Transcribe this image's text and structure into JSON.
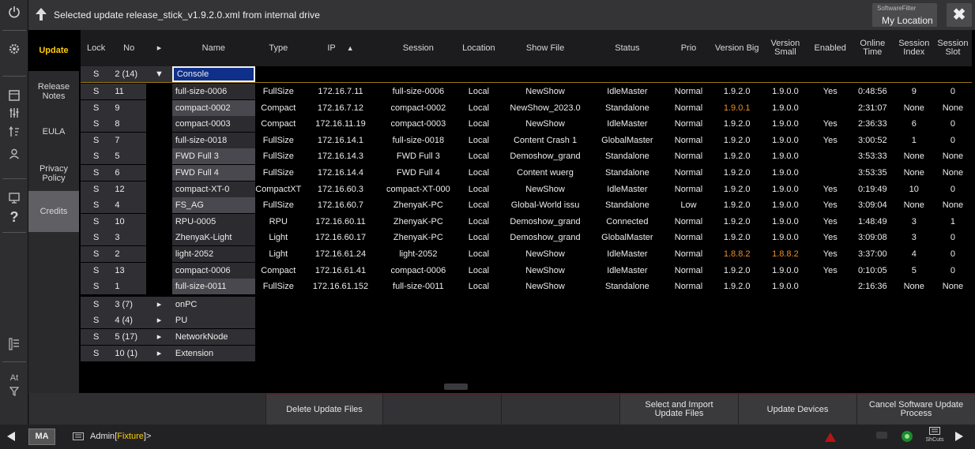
{
  "titlebar": {
    "title": "Selected update release_stick_v1.9.2.0.xml from internal drive"
  },
  "software_filter": {
    "label": "SoftwareFilter",
    "value": "My Location"
  },
  "left_icons": [
    "power-icon",
    "settings-icon",
    "view-icon",
    "filter-icon",
    "sort-icon",
    "user-icon",
    "screen-icon",
    "help-icon",
    "layers-icon",
    "at-icon",
    "funnel-icon"
  ],
  "left_labels": {
    "at": "At",
    "help": "?"
  },
  "tabs": [
    {
      "label": "Update"
    },
    {
      "label": "Release Notes"
    },
    {
      "label": "EULA"
    },
    {
      "label": "Privacy Policy"
    },
    {
      "label": "Credits"
    }
  ],
  "table": {
    "headers": {
      "lock": "Lock",
      "no": "No",
      "arrow": "▸",
      "name": "Name",
      "type": "Type",
      "ip": "IP",
      "ip_sort": "▲",
      "session": "Session",
      "location": "Location",
      "show": "Show File",
      "status": "Status",
      "prio": "Prio",
      "vbig": "Version Big",
      "vsmall": "Version Small",
      "enabled": "Enabled",
      "online": "Online Time",
      "sidx": "Session Index",
      "sslot": "Session Slot"
    },
    "group_rows": [
      {
        "lock": "S",
        "no": "2 (14)",
        "arrow": "▼",
        "name": "Console"
      },
      {
        "lock": "S",
        "no": "3 (7)",
        "arrow": "▸",
        "name": "onPC"
      },
      {
        "lock": "S",
        "no": "4 (4)",
        "arrow": "▸",
        "name": "PU"
      },
      {
        "lock": "S",
        "no": "5 (17)",
        "arrow": "▸",
        "name": "NetworkNode"
      },
      {
        "lock": "S",
        "no": "10 (1)",
        "arrow": "▸",
        "name": "Extension"
      }
    ],
    "rows": [
      {
        "lock": "S",
        "no": "11",
        "name": "full-size-0006",
        "type": "FullSize",
        "ip": "172.16.7.11",
        "session": "full-size-0006",
        "location": "Local",
        "show": "NewShow",
        "status": "IdleMaster",
        "prio": "Normal",
        "vbig": "1.9.2.0",
        "vsmall": "1.9.0.0",
        "enabled": "Yes",
        "online": "0:48:56",
        "sidx": "9",
        "sslot": "0"
      },
      {
        "lock": "S",
        "no": "9",
        "name": "compact-0002",
        "type": "Compact",
        "ip": "172.16.7.12",
        "session": "compact-0002",
        "location": "Local",
        "show": "NewShow_2023.0",
        "status": "Standalone",
        "prio": "Normal",
        "vbig": "1.9.0.1",
        "vsmall": "1.9.0.0",
        "enabled": "",
        "online": "2:31:07",
        "sidx": "None",
        "sslot": "None"
      },
      {
        "lock": "S",
        "no": "8",
        "name": "compact-0003",
        "type": "Compact",
        "ip": "172.16.11.19",
        "session": "compact-0003",
        "location": "Local",
        "show": "NewShow",
        "status": "IdleMaster",
        "prio": "Normal",
        "vbig": "1.9.2.0",
        "vsmall": "1.9.0.0",
        "enabled": "Yes",
        "online": "2:36:33",
        "sidx": "6",
        "sslot": "0"
      },
      {
        "lock": "S",
        "no": "7",
        "name": "full-size-0018",
        "type": "FullSize",
        "ip": "172.16.14.1",
        "session": "full-size-0018",
        "location": "Local",
        "show": "Content Crash 1",
        "status": "GlobalMaster",
        "prio": "Normal",
        "vbig": "1.9.2.0",
        "vsmall": "1.9.0.0",
        "enabled": "Yes",
        "online": "3:00:52",
        "sidx": "1",
        "sslot": "0"
      },
      {
        "lock": "S",
        "no": "5",
        "name": "FWD Full 3",
        "type": "FullSize",
        "ip": "172.16.14.3",
        "session": "FWD Full 3",
        "location": "Local",
        "show": "Demoshow_grand",
        "status": "Standalone",
        "prio": "Normal",
        "vbig": "1.9.2.0",
        "vsmall": "1.9.0.0",
        "enabled": "",
        "online": "3:53:33",
        "sidx": "None",
        "sslot": "None"
      },
      {
        "lock": "S",
        "no": "6",
        "name": "FWD Full 4",
        "type": "FullSize",
        "ip": "172.16.14.4",
        "session": "FWD Full 4",
        "location": "Local",
        "show": "Content wuerg",
        "status": "Standalone",
        "prio": "Normal",
        "vbig": "1.9.2.0",
        "vsmall": "1.9.0.0",
        "enabled": "",
        "online": "3:53:35",
        "sidx": "None",
        "sslot": "None"
      },
      {
        "lock": "S",
        "no": "12",
        "name": "compact-XT-0",
        "type": "CompactXT",
        "ip": "172.16.60.3",
        "session": "compact-XT-000",
        "location": "Local",
        "show": "NewShow",
        "status": "IdleMaster",
        "prio": "Normal",
        "vbig": "1.9.2.0",
        "vsmall": "1.9.0.0",
        "enabled": "Yes",
        "online": "0:19:49",
        "sidx": "10",
        "sslot": "0"
      },
      {
        "lock": "S",
        "no": "4",
        "name": "FS_AG",
        "type": "FullSize",
        "ip": "172.16.60.7",
        "session": "ZhenyaK-PC",
        "location": "Local",
        "show": "Global-World issu",
        "status": "Standalone",
        "prio": "Low",
        "vbig": "1.9.2.0",
        "vsmall": "1.9.0.0",
        "enabled": "Yes",
        "online": "3:09:04",
        "sidx": "None",
        "sslot": "None"
      },
      {
        "lock": "S",
        "no": "10",
        "name": "RPU-0005",
        "type": "RPU",
        "ip": "172.16.60.11",
        "session": "ZhenyaK-PC",
        "location": "Local",
        "show": "Demoshow_grand",
        "status": "Connected",
        "prio": "Normal",
        "vbig": "1.9.2.0",
        "vsmall": "1.9.0.0",
        "enabled": "Yes",
        "online": "1:48:49",
        "sidx": "3",
        "sslot": "1"
      },
      {
        "lock": "S",
        "no": "3",
        "name": "ZhenyaK-Light",
        "type": "Light",
        "ip": "172.16.60.17",
        "session": "ZhenyaK-PC",
        "location": "Local",
        "show": "Demoshow_grand",
        "status": "GlobalMaster",
        "prio": "Normal",
        "vbig": "1.9.2.0",
        "vsmall": "1.9.0.0",
        "enabled": "Yes",
        "online": "3:09:08",
        "sidx": "3",
        "sslot": "0"
      },
      {
        "lock": "S",
        "no": "2",
        "name": "light-2052",
        "type": "Light",
        "ip": "172.16.61.24",
        "session": "light-2052",
        "location": "Local",
        "show": "NewShow",
        "status": "IdleMaster",
        "prio": "Normal",
        "vbig": "1.8.8.2",
        "vsmall": "1.8.8.2",
        "enabled": "Yes",
        "online": "3:37:00",
        "sidx": "4",
        "sslot": "0"
      },
      {
        "lock": "S",
        "no": "13",
        "name": "compact-0006",
        "type": "Compact",
        "ip": "172.16.61.41",
        "session": "compact-0006",
        "location": "Local",
        "show": "NewShow",
        "status": "IdleMaster",
        "prio": "Normal",
        "vbig": "1.9.2.0",
        "vsmall": "1.9.0.0",
        "enabled": "Yes",
        "online": "0:10:05",
        "sidx": "5",
        "sslot": "0"
      },
      {
        "lock": "S",
        "no": "1",
        "name": "full-size-0011",
        "type": "FullSize",
        "ip": "172.16.61.152",
        "session": "full-size-0011",
        "location": "Local",
        "show": "NewShow",
        "status": "Standalone",
        "prio": "Normal",
        "vbig": "1.9.2.0",
        "vsmall": "1.9.0.0",
        "enabled": "",
        "online": "2:16:36",
        "sidx": "None",
        "sslot": "None"
      }
    ]
  },
  "bottom_buttons": {
    "delete": "Delete Update Files",
    "import": "Select and Import Update Files",
    "update": "Update Devices",
    "cancel": "Cancel Software Update Process"
  },
  "cmdline": {
    "logo": "MA",
    "user": "Admin",
    "bracket_open": "[",
    "fixture": "Fixture",
    "bracket_close": "]",
    "prompt": ">",
    "shortcuts": "ShCuts"
  },
  "colors": {
    "accent": "#ffcc00",
    "orange": "#f08d24",
    "bg": "#000000",
    "panel": "#2e2e30"
  }
}
